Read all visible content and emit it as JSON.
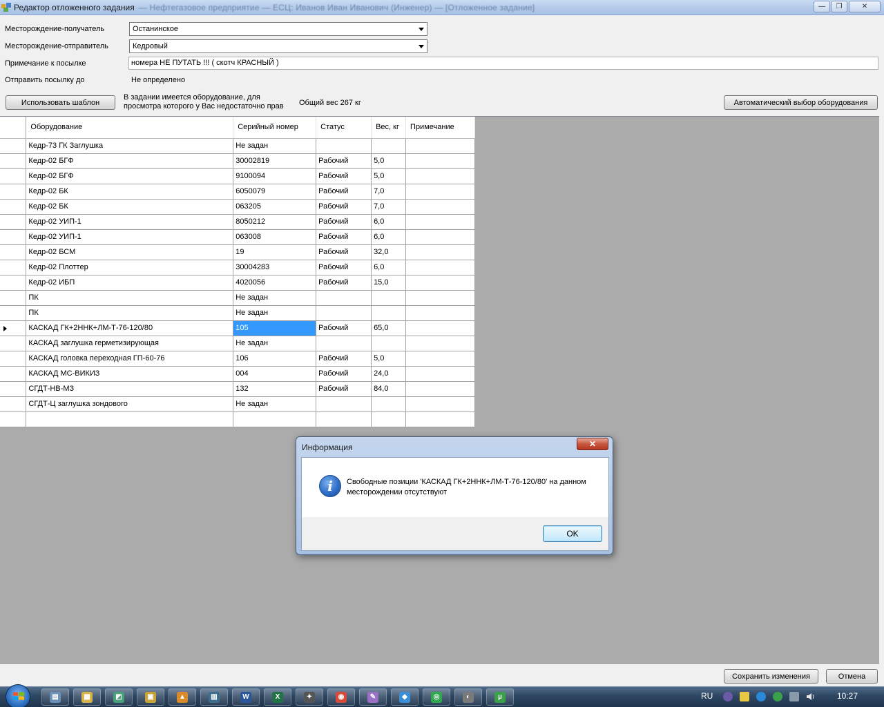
{
  "window": {
    "title": "Редактор отложенного задания",
    "title_extra": "— Нефтегазовое предприятие — ЕСЦ: Иванов Иван Иванович (Инженер) — [Отложенное задание]",
    "min_symbol": "—",
    "max_symbol": "❐",
    "close_symbol": "✕"
  },
  "form": {
    "recipient_label": "Месторождение-получатель",
    "recipient_value": "Останинское",
    "sender_label": "Месторождение-отправитель",
    "sender_value": "Кедровый",
    "note_label": "Примечание к посылке",
    "note_value": "номера НЕ ПУТАТЬ !!! ( скотч КРАСНЫЙ )",
    "send_until_label": "Отправить посылку до",
    "send_until_value": "Не определено",
    "use_template_button": "Использовать шаблон",
    "rights_notice_line1": "В задании имеется оборудование, для",
    "rights_notice_line2": "просмотра которого у Вас недостаточно прав",
    "total_weight": "Общий вес 267 кг",
    "auto_select_button": "Автоматический выбор оборудования"
  },
  "grid": {
    "columns": [
      "Оборудование",
      "Серийный номер",
      "Статус",
      "Вес, кг",
      "Примечание"
    ],
    "rows": [
      [
        "Кедр-73 ГК Заглушка",
        "Не задан",
        "",
        "",
        ""
      ],
      [
        "Кедр-02 БГФ",
        "30002819",
        "Рабочий",
        "5,0",
        ""
      ],
      [
        "Кедр-02 БГФ",
        "9100094",
        "Рабочий",
        "5,0",
        ""
      ],
      [
        "Кедр-02 БК",
        "6050079",
        "Рабочий",
        "7,0",
        ""
      ],
      [
        "Кедр-02 БК",
        "063205",
        "Рабочий",
        "7,0",
        ""
      ],
      [
        "Кедр-02 УИП-1",
        "8050212",
        "Рабочий",
        "6,0",
        ""
      ],
      [
        "Кедр-02 УИП-1",
        "063008",
        "Рабочий",
        "6,0",
        ""
      ],
      [
        "Кедр-02 БСМ",
        "19",
        "Рабочий",
        "32,0",
        ""
      ],
      [
        "Кедр-02 Плоттер",
        "30004283",
        "Рабочий",
        "6,0",
        ""
      ],
      [
        "Кедр-02 ИБП",
        "4020056",
        "Рабочий",
        "15,0",
        ""
      ],
      [
        "ПК",
        "Не задан",
        "",
        "",
        ""
      ],
      [
        "ПК",
        "Не задан",
        "",
        "",
        ""
      ],
      [
        "КАСКАД  ГК+2ННК+ЛМ-Т-76-120/80",
        "105",
        "Рабочий",
        "65,0",
        ""
      ],
      [
        "КАСКАД  заглушка герметизирующая",
        "Не задан",
        "",
        "",
        ""
      ],
      [
        "КАСКАД головка переходная ГП-60-76",
        "106",
        "Рабочий",
        "5,0",
        ""
      ],
      [
        "КАСКАД  МС-ВИКИЗ",
        "004",
        "Рабочий",
        "24,0",
        ""
      ],
      [
        "СГДТ-НВ-МЗ",
        "132",
        "Рабочий",
        "84,0",
        ""
      ],
      [
        "СГДТ-Ц заглушка зондового",
        "Не задан",
        "",
        "",
        ""
      ],
      [
        "",
        "",
        "",
        "",
        ""
      ]
    ],
    "selected_row": 12,
    "selected_col": 1
  },
  "dialog": {
    "title": "Информация",
    "close_symbol": "✕",
    "icon_glyph": "i",
    "message": "Свободные позиции 'КАСКАД  ГК+2ННК+ЛМ-Т-76-120/80' на данном месторождении отсутствуют",
    "ok_button": "OK"
  },
  "footer": {
    "save_button": "Сохранить изменения",
    "cancel_button": "Отмена"
  },
  "taskbar": {
    "language": "RU",
    "clock": "10:27",
    "items": [
      {
        "name": "explorer-window",
        "glyph": "▤",
        "color": "#6e8fb8"
      },
      {
        "name": "folder",
        "glyph": "▦",
        "color": "#d9b44a"
      },
      {
        "name": "network-tool",
        "glyph": "◩",
        "color": "#4aa07a"
      },
      {
        "name": "archive-app",
        "glyph": "▣",
        "color": "#c9a23a"
      },
      {
        "name": "media-app",
        "glyph": "▲",
        "color": "#d98a2a"
      },
      {
        "name": "monitor-app",
        "glyph": "▥",
        "color": "#3d6e8e"
      },
      {
        "name": "word",
        "glyph": "W",
        "color": "#2b579a"
      },
      {
        "name": "excel",
        "glyph": "X",
        "color": "#217346"
      },
      {
        "name": "tool-app",
        "glyph": "✦",
        "color": "#555"
      },
      {
        "name": "chrome",
        "glyph": "◉",
        "color": "#d64a3a"
      },
      {
        "name": "editor-app",
        "glyph": "✎",
        "color": "#9a6fc6"
      },
      {
        "name": "tool-app-2",
        "glyph": "◆",
        "color": "#3a8ed6"
      },
      {
        "name": "browser-app",
        "glyph": "◎",
        "color": "#2fa84f"
      },
      {
        "name": "viewer-app",
        "glyph": "◐",
        "color": "#7a7a7a"
      },
      {
        "name": "utorrent",
        "glyph": "µ",
        "color": "#3aa04a"
      }
    ]
  }
}
